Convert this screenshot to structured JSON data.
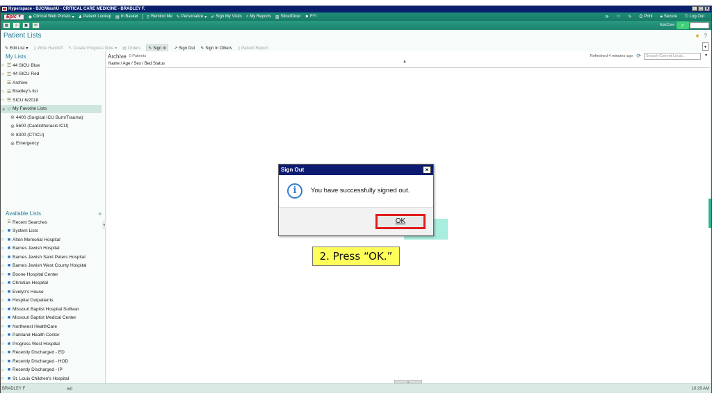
{
  "window": {
    "title": "Hyperspace - BJC/WashU - CRITICAL CARE MEDICINE - BRADLEY F.",
    "controls": [
      "_",
      "□",
      "X"
    ]
  },
  "menubar": {
    "epic_label": "Epic",
    "items": [
      {
        "icon": "globe-icon",
        "label": "Clinical Web Portals",
        "dropdown": true
      },
      {
        "icon": "person-icon",
        "label": "Patient Lookup"
      },
      {
        "icon": "inbox-icon",
        "label": "In Basket"
      },
      {
        "icon": "remind-icon",
        "label": "Remind Me"
      },
      {
        "icon": "wrench-icon",
        "label": "Personalize",
        "dropdown": true
      },
      {
        "icon": "check-icon",
        "label": "Sign My Visits"
      },
      {
        "icon": "search-icon",
        "label": "My Reports"
      },
      {
        "icon": "slicer-icon",
        "label": "SlicerDicer"
      },
      {
        "icon": "fyi-icon",
        "label": "FYI"
      }
    ],
    "right_items": [
      "Print",
      "Secure",
      "Log Out"
    ]
  },
  "toolbar2": {
    "epiccare_label": "EpicCare"
  },
  "page": {
    "title": "Patient Lists",
    "actions": [
      {
        "label": "Edit List",
        "icon": "pencil-icon",
        "enabled": true,
        "dropdown": true
      },
      {
        "label": "Write Handoff",
        "icon": "handoff-icon",
        "enabled": false
      },
      {
        "label": "Create Progress Note",
        "icon": "note-icon",
        "enabled": false,
        "dropdown": true
      },
      {
        "label": "Orders",
        "icon": "orders-icon",
        "enabled": false
      },
      {
        "label": "Sign In",
        "icon": "sign-in-icon",
        "enabled": true,
        "pressed": true
      },
      {
        "label": "Sign Out",
        "icon": "sign-out-icon",
        "enabled": true
      },
      {
        "label": "Sign In Others",
        "icon": "sign-in-others-icon",
        "enabled": true
      },
      {
        "label": "Patient Report",
        "icon": "report-icon",
        "enabled": false
      }
    ]
  },
  "sidebar": {
    "my_lists_title": "My Lists",
    "my_lists": [
      {
        "label": "44 SICU Blue",
        "type": "list",
        "expander": true
      },
      {
        "label": "44 SICU Red",
        "type": "list",
        "expander": true
      },
      {
        "label": "Archive",
        "type": "list",
        "expander": false
      },
      {
        "label": "Bradley's list",
        "type": "list",
        "expander": true
      },
      {
        "label": "SICU 6/2018",
        "type": "list",
        "expander": true
      },
      {
        "label": "My Favorite Lists",
        "type": "star",
        "expander": true,
        "selected": true
      }
    ],
    "favorites": [
      {
        "label": "4400 (Surgical ICU Burn/Trauma)"
      },
      {
        "label": "5600 (Cardiothoracic ICU)"
      },
      {
        "label": "8300 (CTICU)"
      },
      {
        "label": "Emergency"
      }
    ],
    "available_title": "Available Lists",
    "available": [
      {
        "label": "Recent Searches",
        "type": "recent",
        "expander": false
      },
      {
        "label": "System Lists",
        "type": "folder",
        "expander": true
      },
      {
        "label": "Alton Memorial Hospital",
        "type": "folder",
        "expander": true
      },
      {
        "label": "Barnes Jewish Hospital",
        "type": "folder",
        "expander": true
      },
      {
        "label": "Barnes Jewish Saint Peters Hospital",
        "type": "folder",
        "expander": true
      },
      {
        "label": "Barnes Jewish West County Hospital",
        "type": "folder",
        "expander": true
      },
      {
        "label": "Boone Hospital Center",
        "type": "folder",
        "expander": true
      },
      {
        "label": "Christian Hospital",
        "type": "folder",
        "expander": true
      },
      {
        "label": "Evelyn's House",
        "type": "folder",
        "expander": true
      },
      {
        "label": "Hospital Outpatients",
        "type": "folder",
        "expander": true
      },
      {
        "label": "Missouri Baptist Hospital Sullivan",
        "type": "folder",
        "expander": true
      },
      {
        "label": "Missouri Baptist Medical Center",
        "type": "folder",
        "expander": true
      },
      {
        "label": "Northwest HealthCare",
        "type": "folder",
        "expander": true
      },
      {
        "label": "Parkland Health Center",
        "type": "folder",
        "expander": true
      },
      {
        "label": "Progress West Hospital",
        "type": "folder",
        "expander": true
      },
      {
        "label": "Recently Discharged - ED",
        "type": "folder",
        "expander": true
      },
      {
        "label": "Recently Discharged - HOD",
        "type": "folder",
        "expander": true
      },
      {
        "label": "Recently Discharged - IP",
        "type": "folder",
        "expander": true
      },
      {
        "label": "St. Louis Children's Hospital",
        "type": "folder",
        "expander": true
      }
    ]
  },
  "main": {
    "list_title": "Archive",
    "patient_count": "0 Patients",
    "refreshed": "Refreshed 4 minutes ago",
    "search_placeholder": "Search Current Locat...",
    "column_header": "Name / Age / Sex / Bed Status"
  },
  "dialog": {
    "title": "Sign Out",
    "message": "You have successfully signed out.",
    "ok_label": "OK",
    "close_label": "×"
  },
  "callout": {
    "text": "2. Press “OK.”"
  },
  "statusbar": {
    "user": "BRADLEY F",
    "mail_count": "0",
    "time": "10:29 AM"
  }
}
